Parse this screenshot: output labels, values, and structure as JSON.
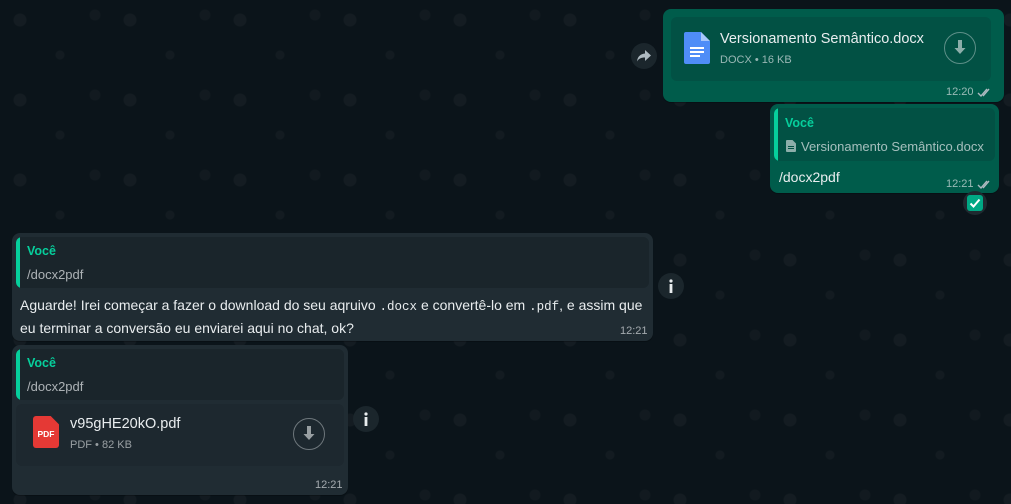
{
  "messages": {
    "m1": {
      "doc_name": "Versionamento Semântico.docx",
      "doc_meta": "DOCX • 16 KB",
      "time": "12:20"
    },
    "m2": {
      "quote_author": "Você",
      "quote_text": "Versionamento Semântico.docx",
      "text": "/docx2pdf",
      "time": "12:21"
    },
    "m3": {
      "quote_author": "Você",
      "quote_text": "/docx2pdf",
      "text_part1": "Aguarde! Irei começar a fazer o download do seu aqruivo ",
      "code1": ".docx",
      "text_part2": " e convertê-lo em ",
      "code2": ".pdf",
      "text_part3": ", e assim que eu terminar a conversão eu enviarei aqui no chat, ok?",
      "time": "12:21"
    },
    "m4": {
      "quote_author": "Você",
      "quote_text": "/docx2pdf",
      "file_name": "v95gHE20kO.pdf",
      "file_meta": "PDF • 82 KB",
      "pdf_label": "PDF",
      "time": "12:21"
    }
  },
  "icons": {
    "forward": "forward-icon",
    "download": "download-icon",
    "info": "info-icon",
    "check": "check-badge-icon",
    "read_ticks": "double-check-icon"
  },
  "colors": {
    "outgoing_bubble": "#005c4b",
    "incoming_bubble": "#202c33",
    "accent": "#06cf9c",
    "pdf_red": "#e53935",
    "doc_blue": "#4f8df7"
  }
}
